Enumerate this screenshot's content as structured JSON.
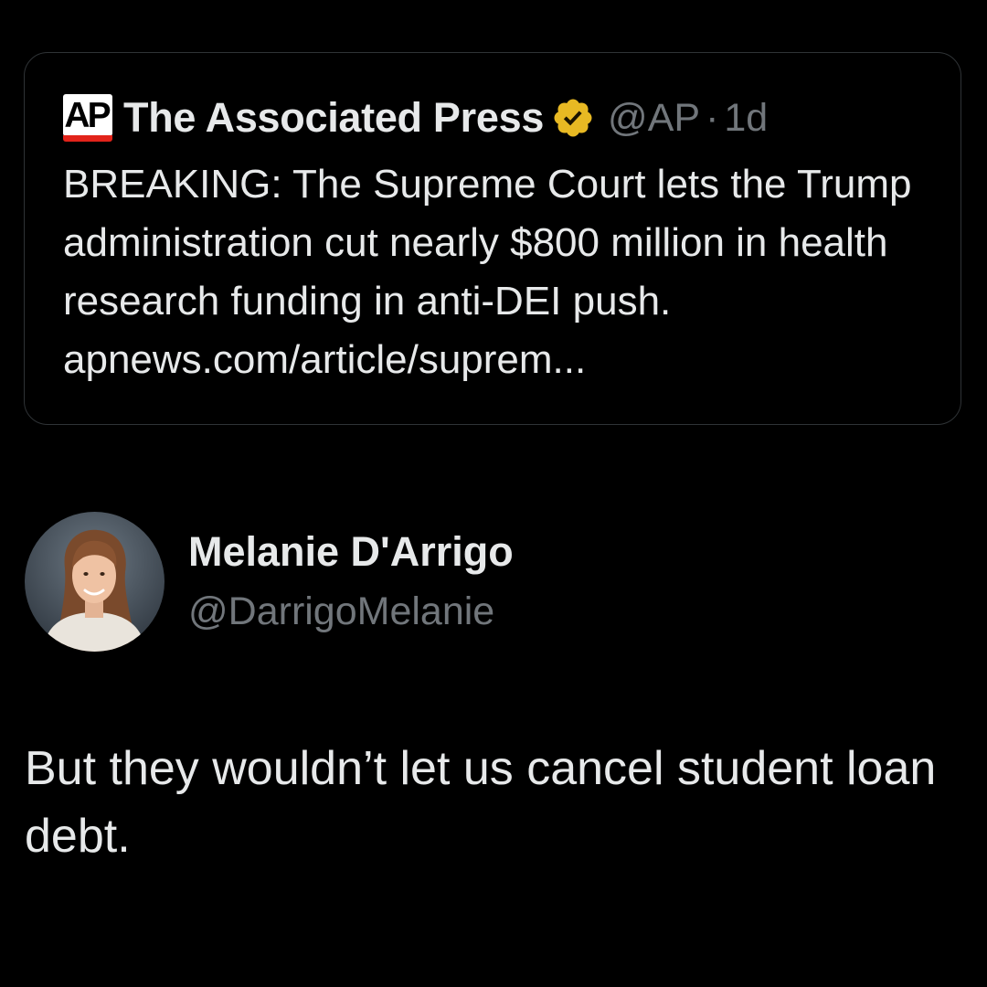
{
  "quoted_post": {
    "source_logo": "AP",
    "author_name": "The Associated Press",
    "verified_badge": "gold-verified-icon",
    "handle": "@AP",
    "separator": "·",
    "time": "1d",
    "text_body": "BREAKING: The Supreme Court lets the Trump administration cut nearly $800 million in health research funding in anti-DEI push. ",
    "link": "apnews.com/article/suprem..."
  },
  "post": {
    "author_name": "Melanie D'Arrigo",
    "handle": "@DarrigoMelanie",
    "text": "But they wouldn’t let us cancel student loan debt."
  },
  "colors": {
    "background": "#000000",
    "primary_text": "#e7e9ea",
    "secondary_text": "#71767b",
    "border": "#2f3336",
    "verified_gold": "#e8b923",
    "ap_red": "#e2231a"
  }
}
